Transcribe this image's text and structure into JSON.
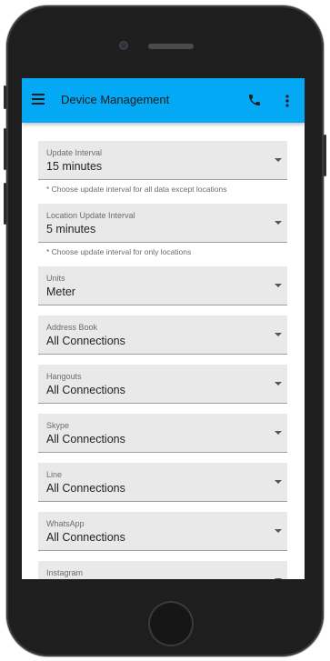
{
  "app": {
    "title": "Device Management",
    "colors": {
      "appbar": "#03a9f4",
      "field_bg": "#e9e9e9"
    },
    "icons": {
      "menu": "menu-icon",
      "call": "phone-icon",
      "more": "more-vertical-icon"
    }
  },
  "fields": [
    {
      "label": "Update Interval",
      "value": "15 minutes",
      "hint": "* Choose update interval for all data except locations"
    },
    {
      "label": "Location Update Interval",
      "value": "5 minutes",
      "hint": "* Choose update interval for only locations"
    },
    {
      "label": "Units",
      "value": "Meter"
    },
    {
      "label": "Address Book",
      "value": "All Connections"
    },
    {
      "label": "Hangouts",
      "value": "All Connections"
    },
    {
      "label": "Skype",
      "value": "All Connections"
    },
    {
      "label": "Line",
      "value": "All Connections"
    },
    {
      "label": "WhatsApp",
      "value": "All Connections"
    },
    {
      "label": "Instagram",
      "value": ""
    }
  ]
}
